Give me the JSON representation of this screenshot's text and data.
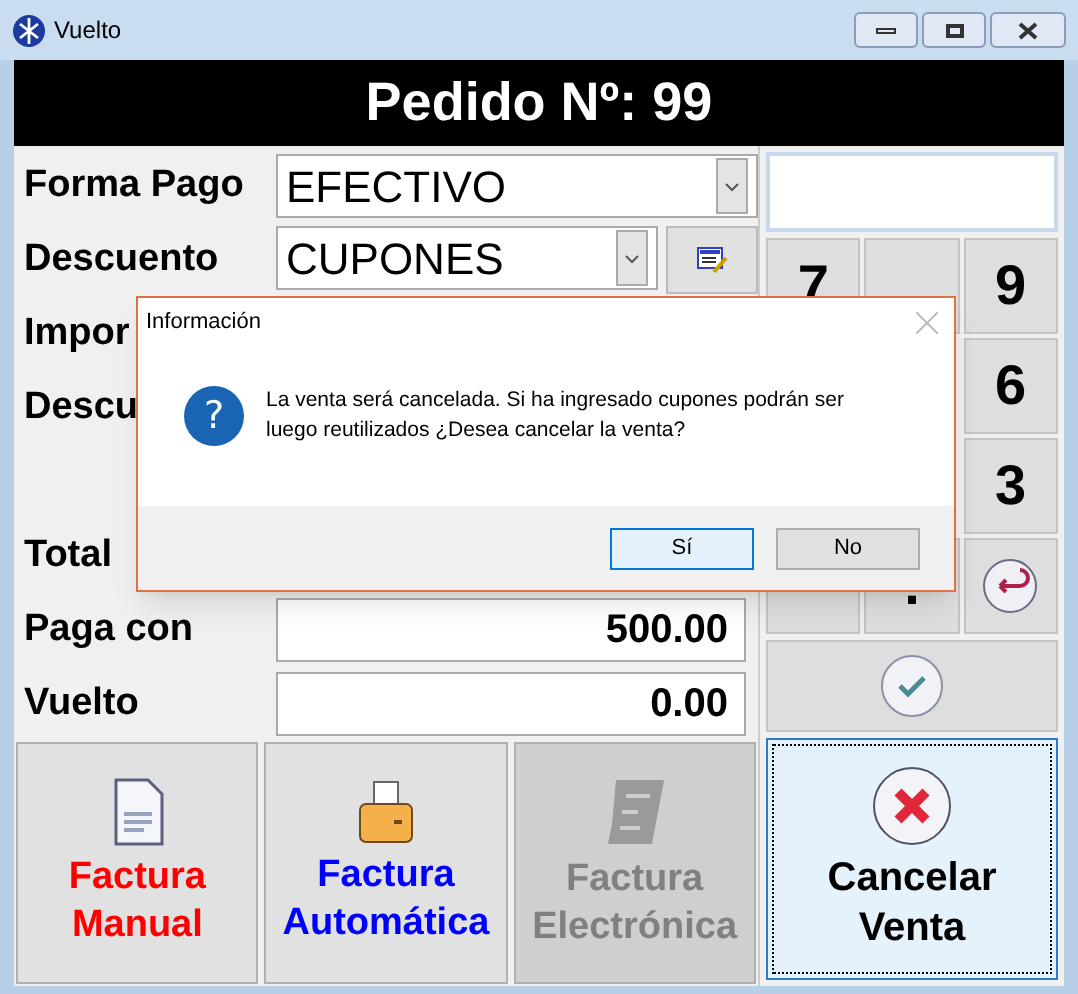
{
  "window": {
    "title": "Vuelto"
  },
  "header": "Pedido Nº: 99",
  "form": [
    {
      "label": "Forma Pago",
      "kind": "combo",
      "value": "EFECTIVO"
    },
    {
      "label": "Descuento",
      "kind": "combo-tool",
      "value": "CUPONES"
    },
    {
      "label": "Impor",
      "kind": "covered"
    },
    {
      "label": "Descu",
      "kind": "covered"
    },
    {
      "kind": "covered"
    },
    {
      "label": "Total",
      "kind": "covered"
    },
    {
      "label": "Paga con",
      "kind": "amount",
      "value": "500.00"
    },
    {
      "label": "Vuelto",
      "kind": "amount",
      "value": "0.00"
    }
  ],
  "invoice_buttons": [
    {
      "line1": "Factura",
      "line2": "Manual",
      "color": "#ff0000",
      "disabled": false,
      "kind": "manual"
    },
    {
      "line1": "Factura",
      "line2": "Automática",
      "color": "#0000ff",
      "disabled": false,
      "kind": "auto"
    },
    {
      "line1": "Factura",
      "line2": "Electrónica",
      "color": "#808080",
      "disabled": true,
      "kind": "electronic"
    }
  ],
  "keypad_rows": [
    [
      "7",
      {
        "kind": "covered"
      },
      "9"
    ],
    [
      "6"
    ],
    [
      "3"
    ],
    [
      {
        "kind": "covered"
      },
      ".",
      {
        "kind": "back"
      }
    ]
  ],
  "cancel_button": {
    "line1": "Cancelar",
    "line2": "Venta"
  },
  "dialog": {
    "title": "Información",
    "icon": "?",
    "message": "La venta será cancelada. Si ha ingresado cupones podrán ser luego reutilizados ¿Desea cancelar la venta?",
    "buttons": [
      {
        "label": "Sí",
        "selected": true
      },
      {
        "label": "No",
        "selected": false
      }
    ]
  }
}
